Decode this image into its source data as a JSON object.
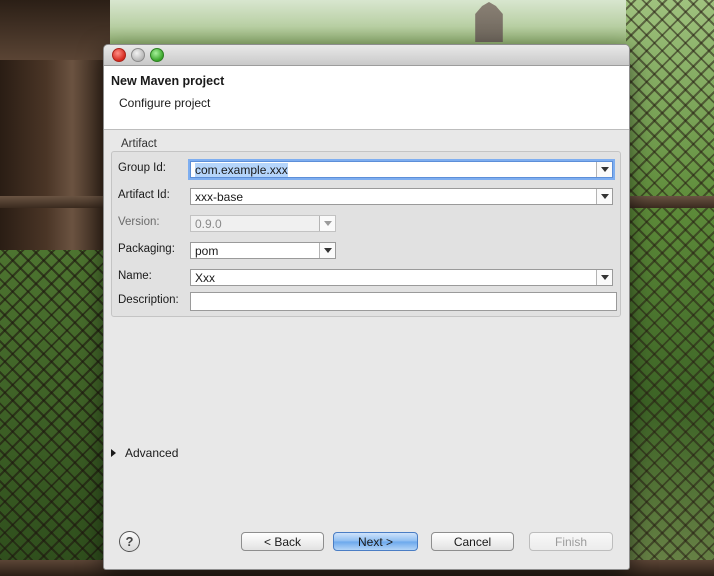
{
  "dialog": {
    "title": "New Maven project",
    "subtitle": "Configure project"
  },
  "artifact": {
    "group_label": "Artifact",
    "group_id": {
      "label": "Group Id:",
      "value": "com.example.xxx"
    },
    "artifact_id": {
      "label": "Artifact Id:",
      "value": "xxx-base"
    },
    "version": {
      "label": "Version:",
      "value": "0.9.0"
    },
    "packaging": {
      "label": "Packaging:",
      "value": "pom"
    },
    "name": {
      "label": "Name:",
      "value": "Xxx"
    },
    "description": {
      "label": "Description:",
      "value": ""
    }
  },
  "advanced": {
    "label": "Advanced"
  },
  "buttons": {
    "help": "?",
    "back": "< Back",
    "next": "Next >",
    "cancel": "Cancel",
    "finish": "Finish"
  },
  "colors": {
    "selection": "#b5d5fb",
    "default_button": "#8bbcf1",
    "close_light": "#d5281d",
    "max_light": "#39a52a"
  }
}
